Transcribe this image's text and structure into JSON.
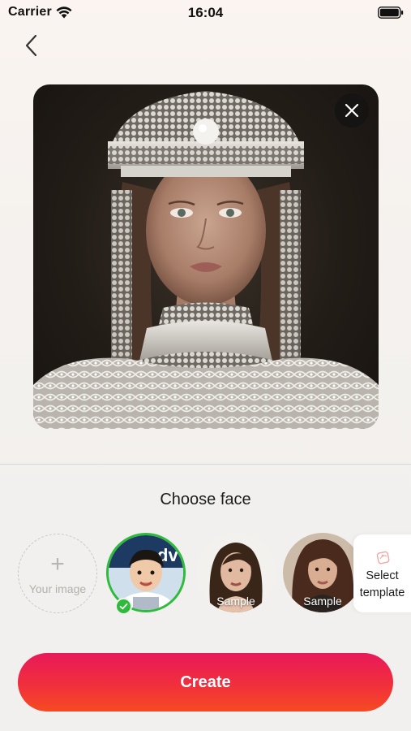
{
  "status_bar": {
    "carrier": "Carrier",
    "time": "16:04"
  },
  "icons": {
    "back": "chevron-left-icon",
    "close": "close-icon",
    "add": "plus-icon",
    "check": "check-icon",
    "template": "template-icon",
    "wifi": "wifi-icon",
    "battery": "battery-icon"
  },
  "preview": {
    "image": "portrait of woman in pearl-embroidered headdress"
  },
  "face_section": {
    "title": "Choose face",
    "upload": {
      "plus": "+",
      "label": "Your image"
    },
    "faces": [
      {
        "selected": true,
        "label": ""
      },
      {
        "selected": false,
        "label": "Sample"
      },
      {
        "selected": false,
        "label": "Sample"
      }
    ],
    "template": {
      "label_line1": "Select",
      "label_line2": "template"
    }
  },
  "actions": {
    "create_label": "Create"
  },
  "colors": {
    "accent_start": "#e8195a",
    "accent_end": "#f64a22",
    "selected_ring": "#2dbb3c"
  }
}
